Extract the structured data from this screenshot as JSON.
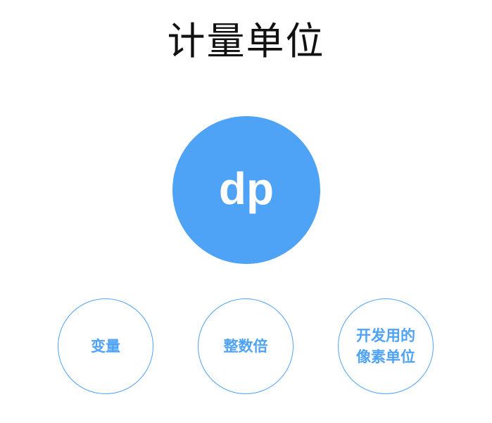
{
  "title": "计量单位",
  "main_circle": {
    "label": "dp",
    "color": "#4fa3f7"
  },
  "sub_circles": [
    {
      "lines": [
        "变量"
      ]
    },
    {
      "lines": [
        "整数倍"
      ]
    },
    {
      "lines": [
        "开发用的",
        "像素单位"
      ]
    }
  ],
  "colors": {
    "accent": "#4fa3f7",
    "title_text": "#111111",
    "background": "#ffffff"
  }
}
